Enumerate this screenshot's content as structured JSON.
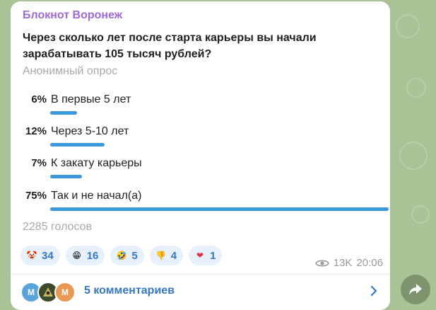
{
  "post": {
    "channel_name": "Блокнот Воронеж",
    "question": "Через сколько лет после старта карьеры вы начали зарабатывать 105 тысяч рублей?",
    "poll_type": "Анонимный опрос",
    "options": [
      {
        "percent_label": "6%",
        "percent": 6,
        "label": "В первые 5 лет"
      },
      {
        "percent_label": "12%",
        "percent": 12,
        "label": "Через 5-10 лет"
      },
      {
        "percent_label": "7%",
        "percent": 7,
        "label": "К закату карьеры"
      },
      {
        "percent_label": "75%",
        "percent": 75,
        "label": "Так и не начал(а)"
      }
    ],
    "votes": "2285 голосов",
    "reactions": [
      {
        "icon": "clown-face-icon",
        "emoji": "🤡",
        "count": "34"
      },
      {
        "icon": "grinning-face-icon",
        "emoji": "😁",
        "count": "16"
      },
      {
        "icon": "rolling-laughing-icon",
        "emoji": "🤣",
        "count": "5"
      },
      {
        "icon": "thumbs-down-icon",
        "emoji": "👎",
        "count": "4"
      },
      {
        "icon": "red-heart-icon",
        "emoji": "❤",
        "count": "1"
      }
    ],
    "views": "13K",
    "time": "20:06",
    "comments": {
      "label": "5 комментариев",
      "avatars": [
        {
          "letter": "M",
          "color": "#5aa4dc"
        },
        {
          "letter": "",
          "color": "#3c4a2e"
        },
        {
          "letter": "M",
          "color": "#e89a52"
        }
      ]
    }
  },
  "colors": {
    "accent": "#3478c4",
    "bar": "#3b98dc",
    "channel": "#9e6ad6"
  }
}
